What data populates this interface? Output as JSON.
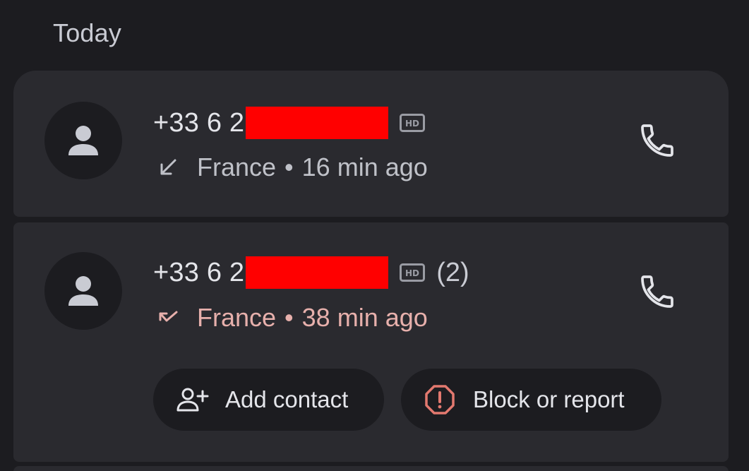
{
  "section": {
    "title": "Today"
  },
  "calls": [
    {
      "number": "+33 6 2",
      "hd": "HD",
      "count": "",
      "country": "France",
      "separator": "•",
      "time": "16 min ago",
      "direction": "incoming",
      "direction_icon": "incoming-call-arrow-icon"
    },
    {
      "number": "+33 6 2",
      "hd": "HD",
      "count": "(2)",
      "country": "France",
      "separator": "•",
      "time": "38 min ago",
      "direction": "missed",
      "direction_icon": "missed-call-arrow-icon"
    }
  ],
  "actions": {
    "add_contact": "Add contact",
    "block_or_report": "Block or report"
  },
  "colors": {
    "background": "#1c1c20",
    "card": "#2a2a2f",
    "missed": "#e7b0ac",
    "block_icon": "#e3796f",
    "redaction": "#ff0000"
  }
}
